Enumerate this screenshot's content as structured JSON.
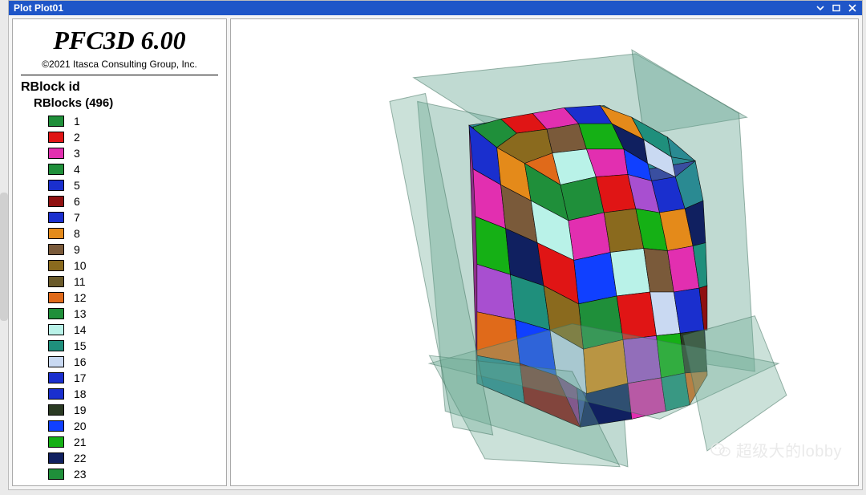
{
  "window": {
    "title": "Plot Plot01"
  },
  "app": {
    "title": "PFC3D 6.00",
    "copyright": "©2021 Itasca Consulting Group, Inc."
  },
  "legend": {
    "title": "RBlock id",
    "subtitle_prefix": "RBlocks",
    "count": "496",
    "items": [
      {
        "id": "1",
        "color": "#1f8f3a"
      },
      {
        "id": "2",
        "color": "#e01515"
      },
      {
        "id": "3",
        "color": "#e22fb0"
      },
      {
        "id": "4",
        "color": "#1f8f3a"
      },
      {
        "id": "5",
        "color": "#1a2fce"
      },
      {
        "id": "6",
        "color": "#8f1010"
      },
      {
        "id": "7",
        "color": "#1a2fce"
      },
      {
        "id": "8",
        "color": "#e48a1a"
      },
      {
        "id": "9",
        "color": "#7a5a3a"
      },
      {
        "id": "10",
        "color": "#8a6a1e"
      },
      {
        "id": "11",
        "color": "#6a5a2a"
      },
      {
        "id": "12",
        "color": "#e06a1a"
      },
      {
        "id": "13",
        "color": "#1f8f3a"
      },
      {
        "id": "14",
        "color": "#b9f2e8"
      },
      {
        "id": "15",
        "color": "#1f8f7c"
      },
      {
        "id": "16",
        "color": "#c9d9f2"
      },
      {
        "id": "17",
        "color": "#1a2fce"
      },
      {
        "id": "18",
        "color": "#1a2fce"
      },
      {
        "id": "19",
        "color": "#2a3a23"
      },
      {
        "id": "20",
        "color": "#1040ff"
      },
      {
        "id": "21",
        "color": "#15b015"
      },
      {
        "id": "22",
        "color": "#102060"
      },
      {
        "id": "23",
        "color": "#1f8f3a"
      }
    ]
  },
  "watermark": {
    "text": "超级大的lobby"
  }
}
